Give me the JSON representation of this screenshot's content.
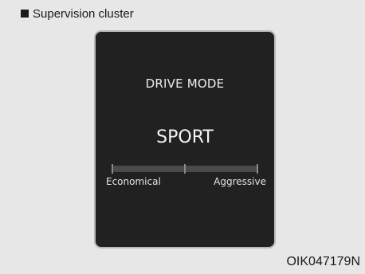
{
  "caption": {
    "icon": "black-square-icon",
    "text": "Supervision cluster"
  },
  "cluster": {
    "title": "DRIVE MODE",
    "mode": "SPORT",
    "scale": {
      "left_label": "Economical",
      "right_label": "Aggressive"
    }
  },
  "figure_code": "OIK047179N",
  "colors": {
    "background": "#e7e7e7",
    "cluster_background": "#222121",
    "cluster_border": "#b9b9b9",
    "gauge_track": "#4a4a4a",
    "text_light": "#ededed"
  }
}
